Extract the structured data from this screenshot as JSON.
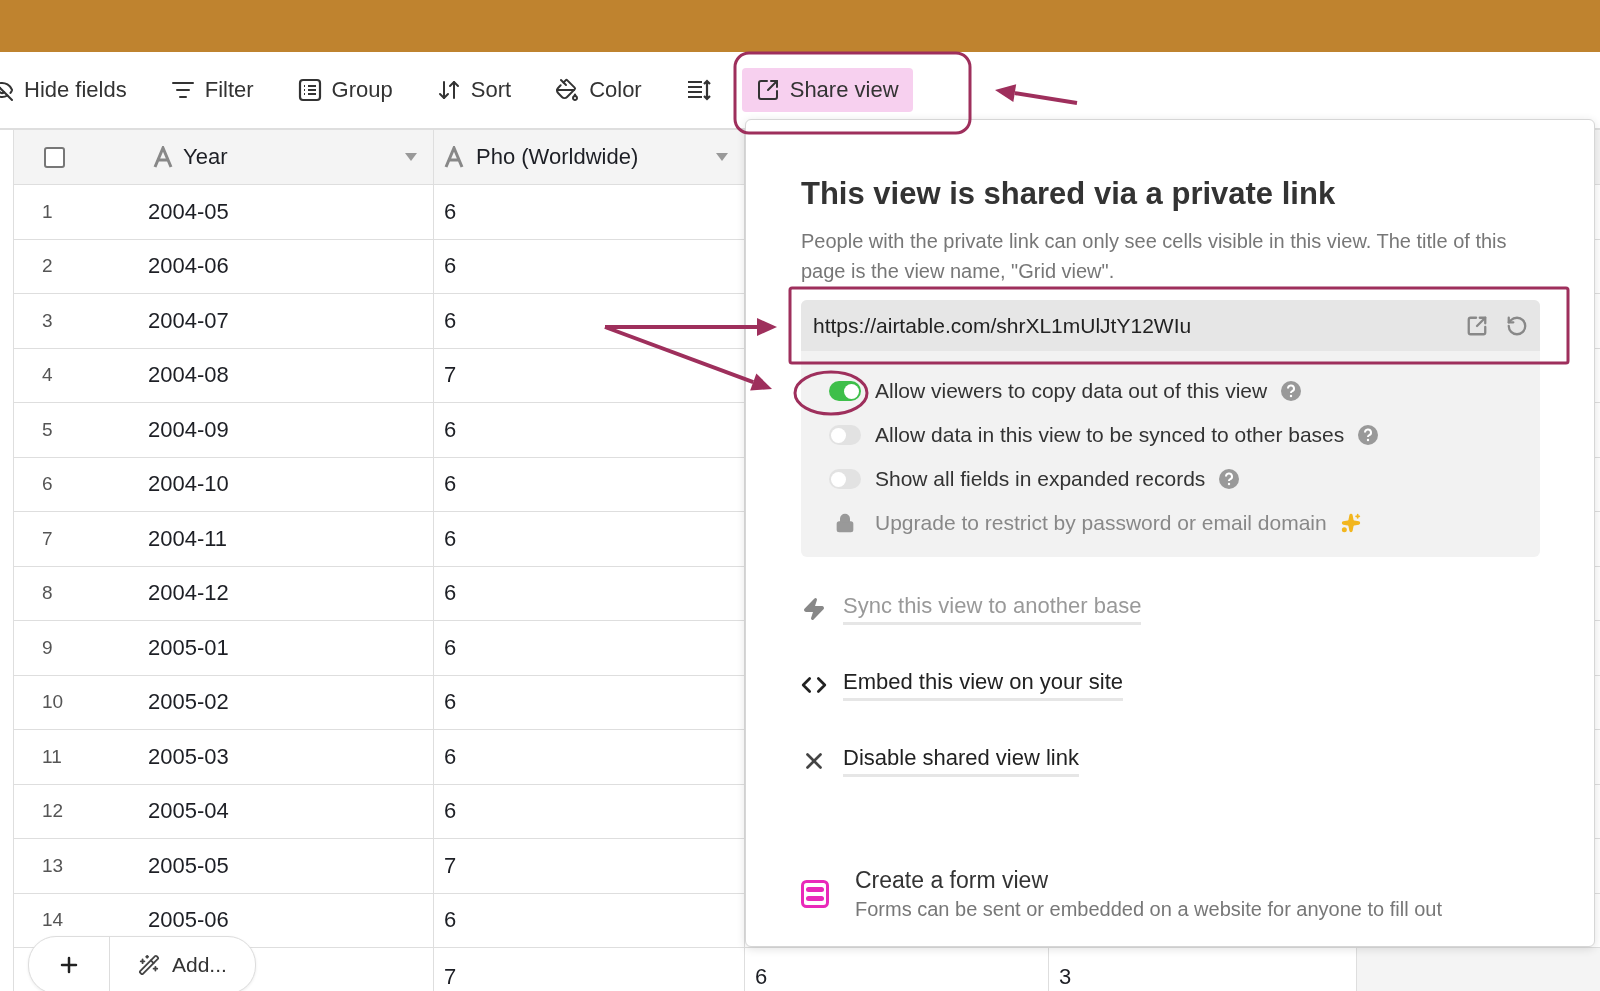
{
  "toolbar": {
    "items": [
      {
        "kind": "hide",
        "label": "Hide fields"
      },
      {
        "kind": "filter",
        "label": "Filter"
      },
      {
        "kind": "group",
        "label": "Group"
      },
      {
        "kind": "sort",
        "label": "Sort"
      },
      {
        "kind": "color",
        "label": "Color"
      },
      {
        "kind": "row-height"
      }
    ],
    "share_button": {
      "label": "Share view",
      "selected": true
    }
  },
  "grid": {
    "select_all": {
      "checked": false
    },
    "columns": [
      {
        "label": "Year"
      },
      {
        "label": "Pho (Worldwide)"
      }
    ],
    "rows": [
      {
        "number": "1",
        "year": "2004-05",
        "pho": "6"
      },
      {
        "number": "2",
        "year": "2004-06",
        "pho": "6"
      },
      {
        "number": "3",
        "year": "2004-07",
        "pho": "6"
      },
      {
        "number": "4",
        "year": "2004-08",
        "pho": "7"
      },
      {
        "number": "5",
        "year": "2004-09",
        "pho": "6"
      },
      {
        "number": "6",
        "year": "2004-10",
        "pho": "6"
      },
      {
        "number": "7",
        "year": "2004-11",
        "pho": "6"
      },
      {
        "number": "8",
        "year": "2004-12",
        "pho": "6"
      },
      {
        "number": "9",
        "year": "2005-01",
        "pho": "6"
      },
      {
        "number": "10",
        "year": "2005-02",
        "pho": "6"
      },
      {
        "number": "11",
        "year": "2005-03",
        "pho": "6"
      },
      {
        "number": "12",
        "year": "2005-04",
        "pho": "6"
      },
      {
        "number": "13",
        "year": "2005-05",
        "pho": "7"
      },
      {
        "number": "14",
        "year": "2005-06",
        "pho": "6"
      }
    ],
    "partial_row": {
      "pho": "7",
      "column_3": "6",
      "column_4": "3"
    }
  },
  "add_bar": {
    "label": "Add..."
  },
  "share_panel": {
    "title": "This view is shared via a private link",
    "description": "People with the private link can only see cells visible in this view. The title of this page is the view name, \"Grid view\".",
    "url": "https://airtable.com/shrXL1mUlJtY12WIu",
    "options": [
      {
        "kind": "toggle",
        "label": "Allow viewers to copy data out of this view",
        "on": true
      },
      {
        "kind": "toggle",
        "label": "Allow data in this view to be synced to other bases",
        "on": false
      },
      {
        "kind": "toggle",
        "label": "Show all fields in expanded records",
        "on": false
      },
      {
        "kind": "locked",
        "label": "Upgrade to restrict by password or email domain"
      }
    ],
    "actions": [
      {
        "kind": "sync",
        "label": "Sync this view to another base",
        "disabled": true
      },
      {
        "kind": "embed",
        "label": "Embed this view on your site",
        "disabled": false
      },
      {
        "kind": "disable",
        "label": "Disable shared view link",
        "disabled": false
      }
    ],
    "form_view": {
      "title": "Create a form view",
      "description": "Forms can be sent or embedded on a website for anyone to fill out"
    }
  }
}
